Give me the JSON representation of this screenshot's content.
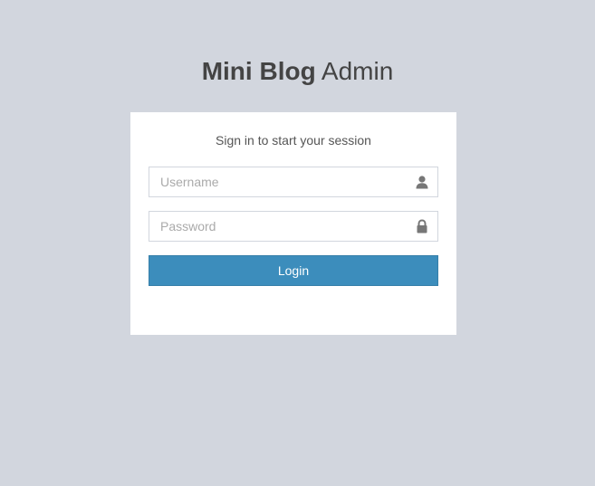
{
  "header": {
    "brand_bold": "Mini Blog",
    "brand_light": " Admin"
  },
  "login_box": {
    "message": "Sign in to start your session",
    "username": {
      "value": "",
      "placeholder": "Username",
      "icon": "user-icon"
    },
    "password": {
      "value": "",
      "placeholder": "Password",
      "icon": "lock-icon"
    },
    "submit_label": "Login"
  },
  "colors": {
    "background": "#d2d6de",
    "primary": "#3c8dbc",
    "icon": "#777777"
  }
}
